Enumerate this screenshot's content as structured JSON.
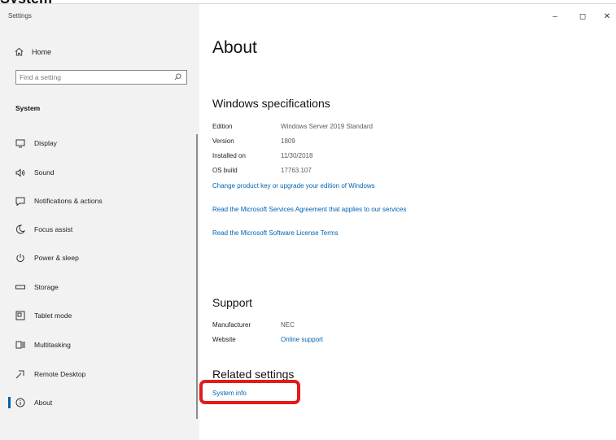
{
  "window": {
    "title": "Settings",
    "minimize_glyph": "–",
    "restore_glyph": "◻",
    "close_glyph": "✕"
  },
  "sidebar": {
    "home_label": "Home",
    "search_placeholder": "Find a setting",
    "section_label": "System",
    "items": [
      {
        "label": "Display",
        "icon": "display-icon"
      },
      {
        "label": "Sound",
        "icon": "sound-icon"
      },
      {
        "label": "Notifications & actions",
        "icon": "notifications-icon"
      },
      {
        "label": "Focus assist",
        "icon": "focus-assist-icon"
      },
      {
        "label": "Power & sleep",
        "icon": "power-icon"
      },
      {
        "label": "Storage",
        "icon": "storage-icon"
      },
      {
        "label": "Tablet mode",
        "icon": "tablet-mode-icon"
      },
      {
        "label": "Multitasking",
        "icon": "multitasking-icon"
      },
      {
        "label": "Remote Desktop",
        "icon": "remote-desktop-icon"
      },
      {
        "label": "About",
        "icon": "about-icon",
        "selected": true
      }
    ]
  },
  "main": {
    "title": "About",
    "specs_title": "Windows specifications",
    "specs": [
      {
        "key": "Edition",
        "value": "Windows Server 2019 Standard"
      },
      {
        "key": "Version",
        "value": "1809"
      },
      {
        "key": "Installed on",
        "value": "11/30/2018"
      },
      {
        "key": "OS build",
        "value": "17763.107"
      }
    ],
    "links": {
      "change_key": "Change product key or upgrade your edition of Windows",
      "services_agreement": "Read the Microsoft Services Agreement that applies to our services",
      "license_terms": "Read the Microsoft Software License Terms"
    },
    "support_title": "Support",
    "support": {
      "manufacturer_key": "Manufacturer",
      "manufacturer_value": "NEC",
      "website_key": "Website",
      "website_value": "Online support"
    },
    "related_title": "Related settings",
    "system_info_link": "System info"
  },
  "colors": {
    "accent": "#0063b1",
    "sidebar_bg": "#f2f2f2",
    "highlight": "#e31b1b"
  }
}
